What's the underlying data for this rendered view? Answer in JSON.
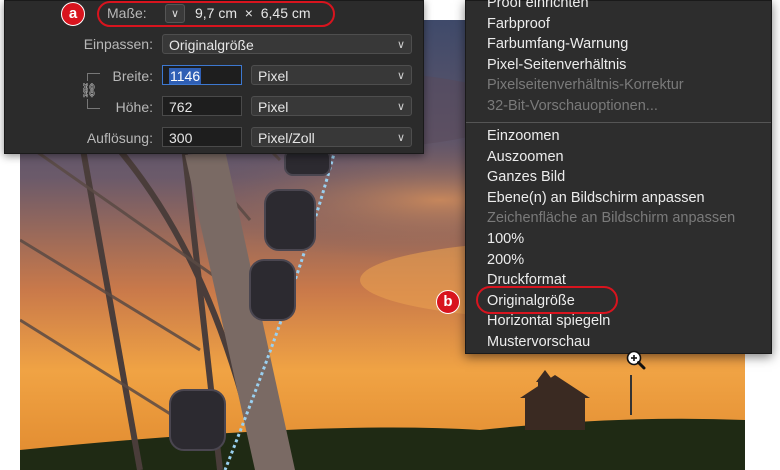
{
  "dialog": {
    "masse_label": "Maße:",
    "masse_value": "9,7 cm  ×  6,45 cm",
    "fit_label": "Einpassen:",
    "fit_value": "Originalgröße",
    "width_label": "Breite:",
    "width_value": "1146",
    "width_unit": "Pixel",
    "height_label": "Höhe:",
    "height_value": "762",
    "height_unit": "Pixel",
    "resolution_label": "Auflösung:",
    "resolution_value": "300",
    "resolution_unit": "Pixel/Zoll",
    "badge": "a"
  },
  "menu": {
    "items_top": [
      {
        "label": "Proof einrichten",
        "enabled": true
      },
      {
        "label": "Farbproof",
        "enabled": true
      },
      {
        "label": "Farbumfang-Warnung",
        "enabled": true
      },
      {
        "label": "Pixel-Seitenverhältnis",
        "enabled": true
      },
      {
        "label": "Pixelseitenverhältnis-Korrektur",
        "enabled": false
      },
      {
        "label": "32-Bit-Vorschauoptionen...",
        "enabled": false
      }
    ],
    "items_bottom": [
      {
        "label": "Einzoomen",
        "enabled": true
      },
      {
        "label": "Auszoomen",
        "enabled": true
      },
      {
        "label": "Ganzes Bild",
        "enabled": true
      },
      {
        "label": "Ebene(n) an Bildschirm anpassen",
        "enabled": true
      },
      {
        "label": "Zeichenfläche an Bildschirm anpassen",
        "enabled": false
      },
      {
        "label": "100%",
        "enabled": true
      },
      {
        "label": "200%",
        "enabled": true
      },
      {
        "label": "Druckformat",
        "enabled": true
      },
      {
        "label": "Originalgröße",
        "enabled": true
      },
      {
        "label": "Horizontal spiegeln",
        "enabled": true
      },
      {
        "label": "Mustervorschau",
        "enabled": true
      }
    ],
    "badge": "b"
  },
  "colors": {
    "accent_red": "#d8141e",
    "sky_top": "#3d4a6b",
    "sky_glow": "#f0a040"
  },
  "icons": [
    "chevron-down-icon",
    "chain-link-icon",
    "zoom-in-icon"
  ]
}
